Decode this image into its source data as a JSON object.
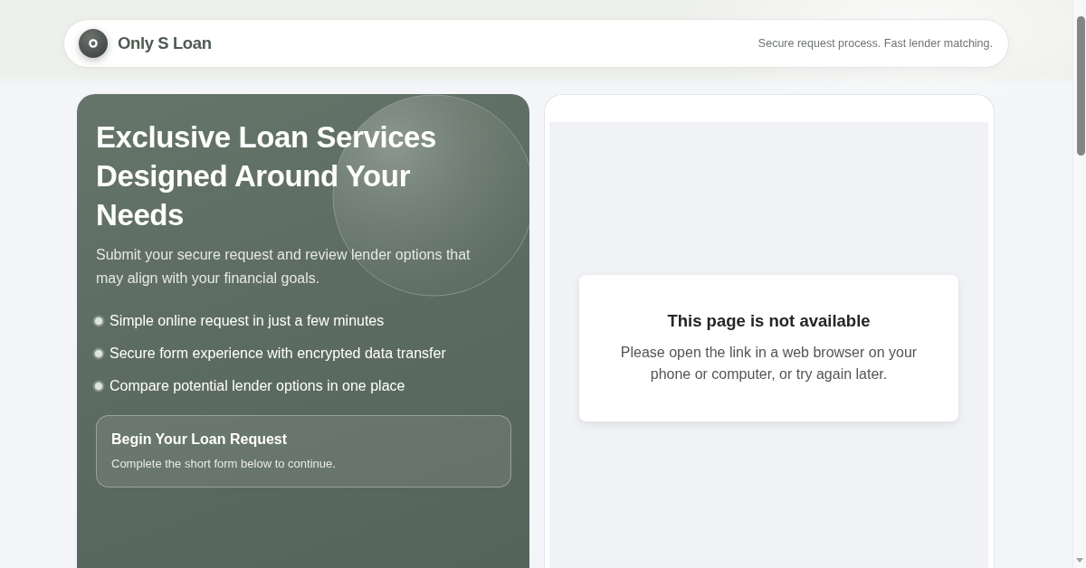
{
  "header": {
    "brand": "Only S Loan",
    "tagline": "Secure request process. Fast lender matching."
  },
  "hero": {
    "heading": "Exclusive Loan Services Designed Around Your Needs",
    "subtitle": "Submit your secure request and review lender options that may align with your financial goals.",
    "features": [
      "Simple online request in just a few minutes",
      "Secure form experience with encrypted data transfer",
      "Compare potential lender options in one place"
    ],
    "cta": {
      "title": "Begin Your Loan Request",
      "text": "Complete the short form below to continue."
    }
  },
  "embed": {
    "notice": {
      "title": "This page is not available",
      "message": "Please open the link in a web browser on your phone or computer, or try again later."
    }
  }
}
